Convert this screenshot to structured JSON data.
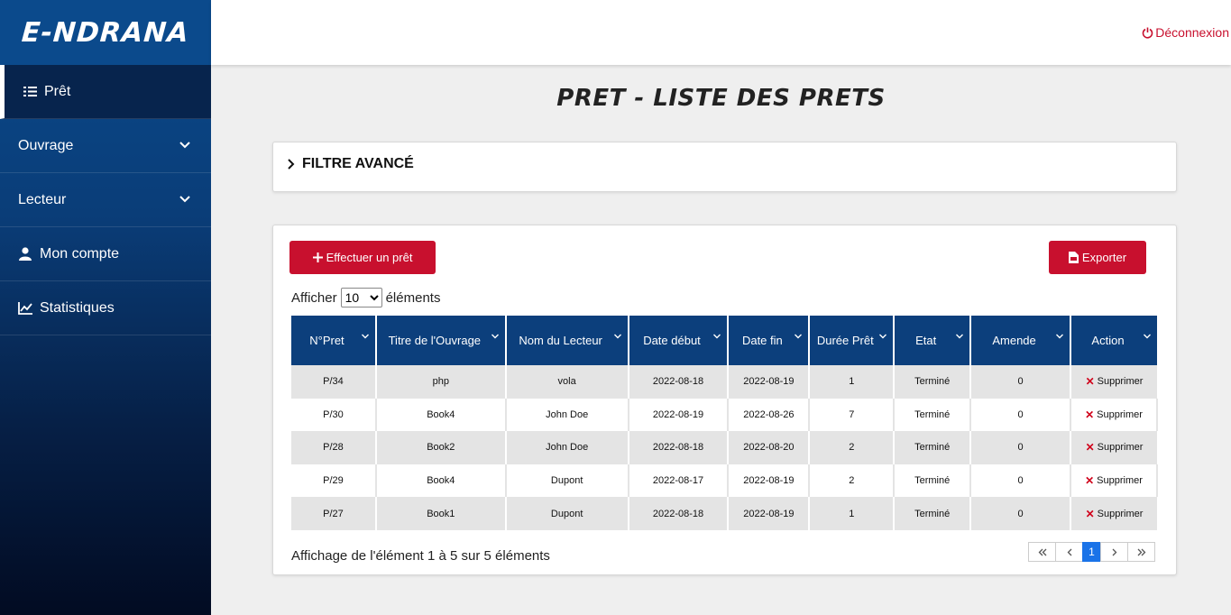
{
  "brand": {
    "logo_text": "E-NDRANA"
  },
  "sidebar": {
    "items": [
      {
        "label": "Prêt",
        "icon": "list-icon",
        "active": true
      },
      {
        "label": "Ouvrage",
        "icon": "",
        "expandable": true
      },
      {
        "label": "Lecteur",
        "icon": "",
        "expandable": true
      },
      {
        "label": "Mon compte",
        "icon": "user-icon"
      },
      {
        "label": "Statistiques",
        "icon": "chart-line-icon"
      }
    ]
  },
  "topbar": {
    "logout_label": "Déconnexion",
    "logout_icon": "power-icon"
  },
  "page": {
    "title": "PRET - LISTE DES PRETS"
  },
  "filter": {
    "label": "FILTRE AVANCÉ"
  },
  "actions": {
    "add_label": "Effectuer un prêt",
    "export_label": "Exporter"
  },
  "length": {
    "prefix": "Afficher",
    "selected": "10",
    "suffix": "éléments"
  },
  "table": {
    "columns": [
      "N°Pret",
      "Titre de l'Ouvrage",
      "Nom du Lecteur",
      "Date début",
      "Date fin",
      "Durée Prêt",
      "Etat",
      "Amende",
      "Action"
    ],
    "rows": [
      {
        "num": "P/34",
        "titre": "php",
        "lecteur": "vola",
        "debut": "2022-08-18",
        "fin": "2022-08-19",
        "duree": "1",
        "etat": "Terminé",
        "amende": "0",
        "action": "Supprimer"
      },
      {
        "num": "P/30",
        "titre": "Book4",
        "lecteur": "John Doe",
        "debut": "2022-08-19",
        "fin": "2022-08-26",
        "duree": "7",
        "etat": "Terminé",
        "amende": "0",
        "action": "Supprimer"
      },
      {
        "num": "P/28",
        "titre": "Book2",
        "lecteur": "John Doe",
        "debut": "2022-08-18",
        "fin": "2022-08-20",
        "duree": "2",
        "etat": "Terminé",
        "amende": "0",
        "action": "Supprimer"
      },
      {
        "num": "P/29",
        "titre": "Book4",
        "lecteur": "Dupont",
        "debut": "2022-08-17",
        "fin": "2022-08-19",
        "duree": "2",
        "etat": "Terminé",
        "amende": "0",
        "action": "Supprimer"
      },
      {
        "num": "P/27",
        "titre": "Book1",
        "lecteur": "Dupont",
        "debut": "2022-08-18",
        "fin": "2022-08-19",
        "duree": "1",
        "etat": "Terminé",
        "amende": "0",
        "action": "Supprimer"
      }
    ]
  },
  "footer": {
    "info": "Affichage de l'élément 1 à 5 sur 5 éléments",
    "pagination": {
      "current": "1"
    }
  },
  "colors": {
    "accent_red": "#c8102e",
    "header_blue": "#0c3f7c",
    "sidebar_blue": "#0b4a8c"
  }
}
